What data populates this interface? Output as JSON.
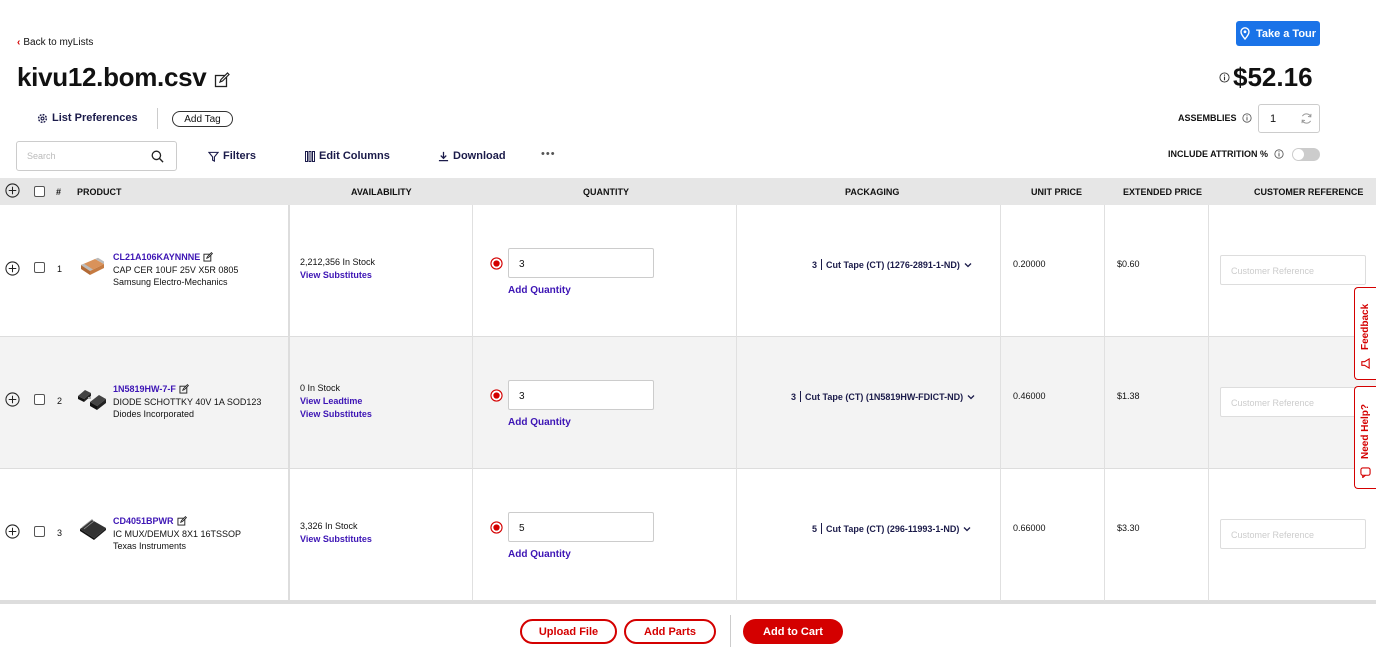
{
  "header": {
    "back_label": "Back to myLists",
    "list_title": "kivu12.bom.csv",
    "tour_label": "Take a Tour",
    "total": "$52.16",
    "list_preferences_label": "List Preferences",
    "add_tag_label": "Add Tag",
    "assemblies_label": "ASSEMBLIES",
    "assemblies_value": "1",
    "attrition_label": "INCLUDE ATTRITION %",
    "attrition_on": false
  },
  "toolbar": {
    "search_placeholder": "Search",
    "filters_label": "Filters",
    "edit_columns_label": "Edit Columns",
    "download_label": "Download",
    "more_label": "•••"
  },
  "table": {
    "columns": {
      "index": "#",
      "product": "PRODUCT",
      "availability": "AVAILABILITY",
      "quantity": "QUANTITY",
      "packaging": "PACKAGING",
      "unit_price": "UNIT PRICE",
      "extended_price": "EXTENDED PRICE",
      "customer_reference": "CUSTOMER REFERENCE"
    },
    "rows": [
      {
        "index": "1",
        "part_number": "CL21A106KAYNNNE",
        "description": "CAP CER 10UF 25V X5R 0805",
        "manufacturer": "Samsung Electro-Mechanics",
        "stock": "2,212,356 In Stock",
        "link1": "View Substitutes",
        "link2": "",
        "quantity": "3",
        "add_quantity": "Add Quantity",
        "pack_qty": "3",
        "pack_desc": "Cut Tape (CT)  (1276-2891-1-ND)",
        "unit_price": "0.20000",
        "extended_price": "$0.60",
        "customer_ref_placeholder": "Customer Reference"
      },
      {
        "index": "2",
        "part_number": "1N5819HW-7-F",
        "description": "DIODE SCHOTTKY 40V 1A SOD123",
        "manufacturer": "Diodes Incorporated",
        "stock": "0 In Stock",
        "link1": "View Leadtime",
        "link2": "View Substitutes",
        "quantity": "3",
        "add_quantity": "Add Quantity",
        "pack_qty": "3",
        "pack_desc": "Cut Tape (CT)  (1N5819HW-FDICT-ND)",
        "unit_price": "0.46000",
        "extended_price": "$1.38",
        "customer_ref_placeholder": "Customer Reference"
      },
      {
        "index": "3",
        "part_number": "CD4051BPWR",
        "description": "IC MUX/DEMUX 8X1 16TSSOP",
        "manufacturer": "Texas Instruments",
        "stock": "3,326 In Stock",
        "link1": "View Substitutes",
        "link2": "",
        "quantity": "5",
        "add_quantity": "Add Quantity",
        "pack_qty": "5",
        "pack_desc": "Cut Tape (CT)  (296-11993-1-ND)",
        "unit_price": "0.66000",
        "extended_price": "$3.30",
        "customer_ref_placeholder": "Customer Reference"
      }
    ]
  },
  "side_tabs": {
    "feedback": "Feedback",
    "need_help": "Need Help?"
  },
  "footer": {
    "upload_file": "Upload File",
    "add_parts": "Add Parts",
    "add_to_cart": "Add to Cart"
  },
  "colors": {
    "accent_red": "#d40000",
    "link_purple": "#3d15b5",
    "tour_blue": "#1a73e8"
  }
}
